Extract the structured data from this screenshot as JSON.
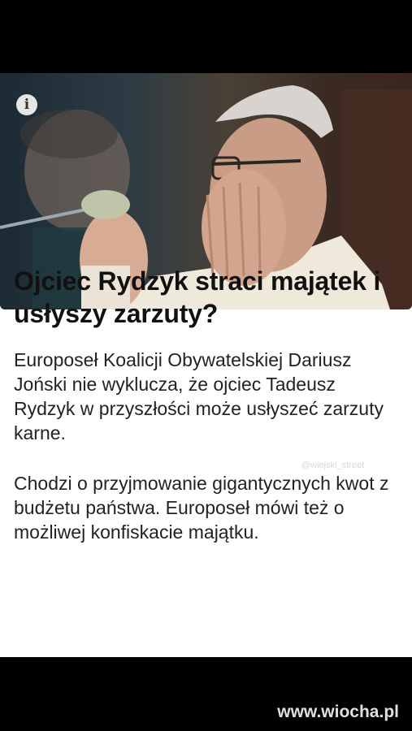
{
  "article": {
    "headline": "Ojciec Rydzyk straci majątek i usłyszy zarzuty?",
    "paragraph_1": "Europoseł Koalicji Obywatelskiej Dariusz Joński nie wyklucza, że ojciec Tadeusz Rydzyk w przyszłości może usłyszeć zarzuty karne.",
    "paragraph_2": "Chodzi o przyjmowanie gigantycznych kwot z budżetu państwa. Europoseł mówi też o możliwej konfiskacie majątku.",
    "info_icon_glyph": "i"
  },
  "watermarks": {
    "small": "@wiejski_street",
    "site": "www.wiocha.pl"
  },
  "colors": {
    "background": "#000000",
    "card": "#ffffff",
    "text": "#111111"
  },
  "icons": [
    "info-icon"
  ]
}
